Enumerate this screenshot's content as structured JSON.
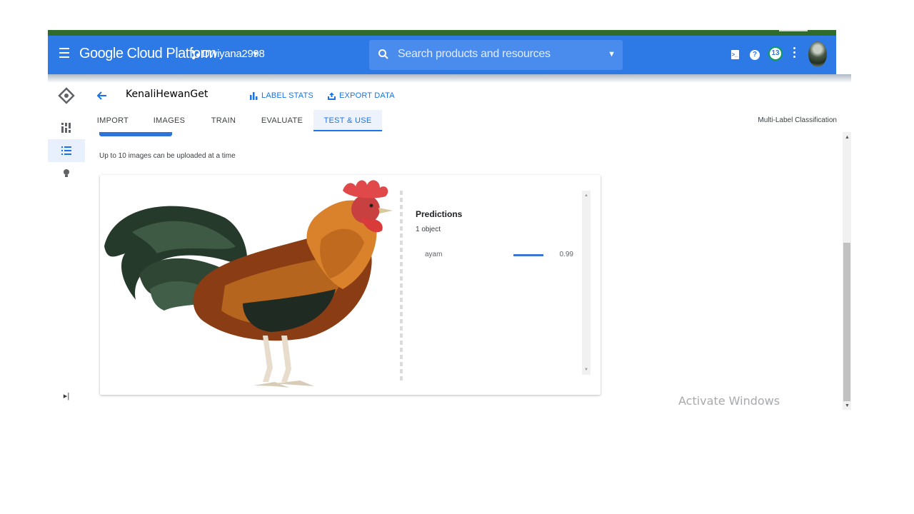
{
  "topbar": {
    "title": "Google Cloud Platform",
    "project": "Dwiyana2998",
    "search_placeholder": "Search products and resources",
    "notification_count": "13"
  },
  "header": {
    "dataset_name": "KenaliHewanGet",
    "label_stats": "LABEL STATS",
    "export_data": "EXPORT DATA"
  },
  "tabs": [
    {
      "label": "IMPORT"
    },
    {
      "label": "IMAGES"
    },
    {
      "label": "TRAIN"
    },
    {
      "label": "EVALUATE"
    },
    {
      "label": "TEST & USE"
    }
  ],
  "model_type": "Multi-Label Classification",
  "hint": "Up to 10 images can be uploaded at a time",
  "predictions": {
    "title": "Predictions",
    "count": "1 object",
    "items": [
      {
        "label": "ayam",
        "score": "0.99",
        "score_value": 0.99
      }
    ]
  },
  "watermark": "Activate Windows",
  "colors": {
    "topbar": "#2d7ae6",
    "accent": "#1a73e8",
    "notification_ring": "#0f9d58"
  }
}
